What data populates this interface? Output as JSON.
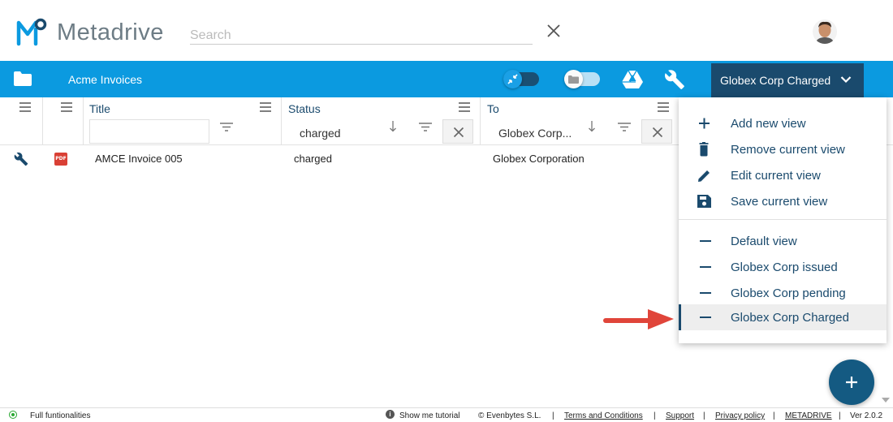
{
  "app": {
    "name": "Metadrive"
  },
  "search": {
    "placeholder": "Search"
  },
  "toolbar": {
    "folder_title": "Acme Invoices",
    "current_view": "Globex Corp Charged"
  },
  "grid": {
    "columns": [
      {
        "title": "Title",
        "filter_value": ""
      },
      {
        "title": "Status",
        "filter_value": "charged"
      },
      {
        "title": "To",
        "filter_value": "Globex Corp..."
      }
    ],
    "rows": [
      {
        "file_type": "PDF",
        "title": "AMCE Invoice 005",
        "status": "charged",
        "to": "Globex Corporation"
      }
    ]
  },
  "dropdown": {
    "actions": [
      {
        "label": "Add new view",
        "icon": "plus-icon"
      },
      {
        "label": "Remove current view",
        "icon": "trash-icon"
      },
      {
        "label": "Edit current view",
        "icon": "pencil-icon"
      },
      {
        "label": "Save current view",
        "icon": "save-icon"
      }
    ],
    "views": [
      {
        "label": "Default view",
        "active": false
      },
      {
        "label": "Globex Corp issued",
        "active": false
      },
      {
        "label": "Globex Corp pending",
        "active": false
      },
      {
        "label": "Globex Corp Charged",
        "active": true
      }
    ]
  },
  "footer": {
    "status": "Full funtionalities",
    "tutorial": "Show me tutorial",
    "copyright": "© Evenbytes S.L.",
    "links": [
      "Terms and Conditions",
      "Support",
      "Privacy policy",
      "METADRIVE"
    ],
    "version": "Ver 2.0.2",
    "separator": "|"
  },
  "colors": {
    "primary_blue": "#0b9ae0",
    "dark_navy": "#1a4a6d",
    "fab": "#145a82",
    "arrow_red": "#e0453a"
  }
}
